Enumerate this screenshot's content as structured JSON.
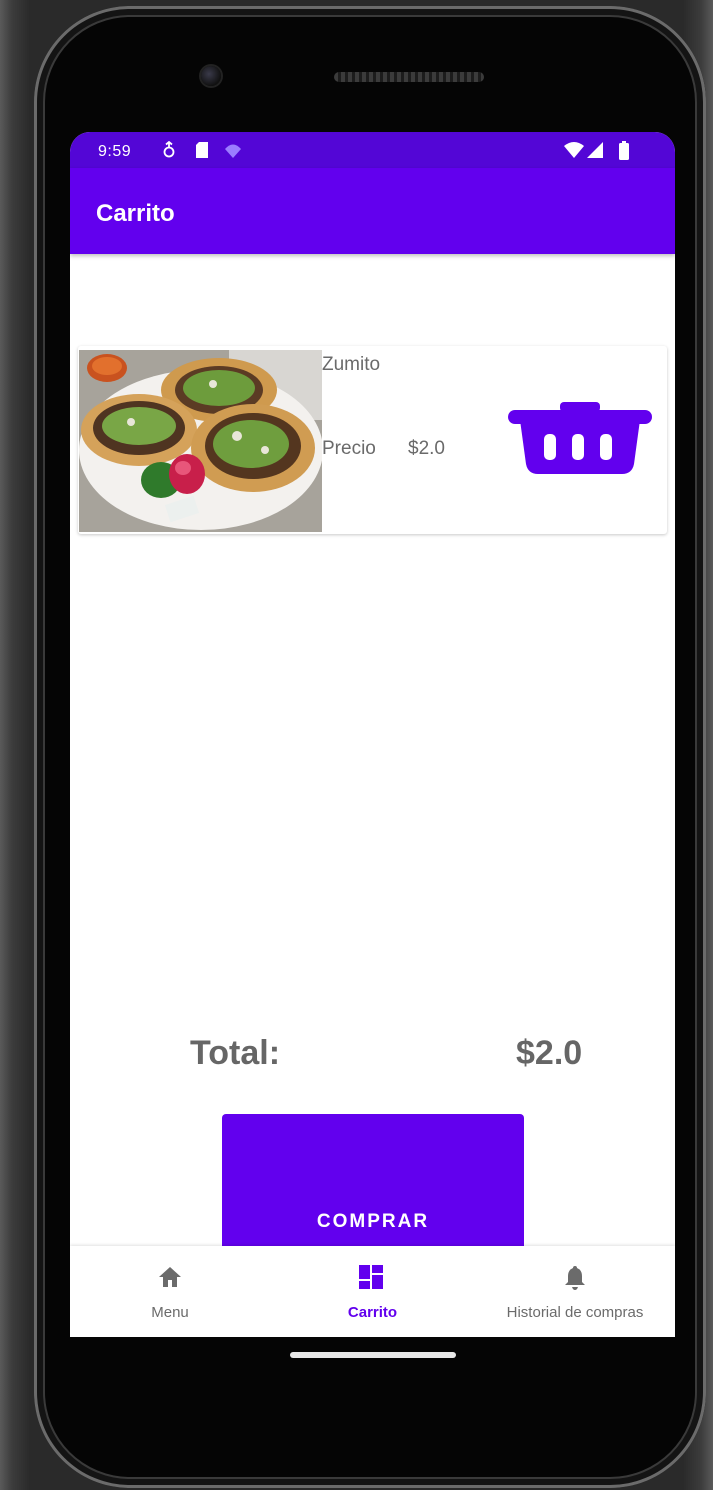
{
  "status_bar": {
    "time": "9:59",
    "icons": [
      "location-icon",
      "sd-card-icon",
      "vpn-key-icon",
      "wifi-icon",
      "signal-icon",
      "battery-icon"
    ]
  },
  "app_bar": {
    "title": "Carrito"
  },
  "cart": {
    "items": [
      {
        "name": "Zumito",
        "price_label": "Precio",
        "price": "$2.0",
        "image": "tacos-photo",
        "action_icon": "delete-basket-icon"
      }
    ]
  },
  "summary": {
    "total_label": "Total:",
    "total_value": "$2.0"
  },
  "buy_button": {
    "label": "COMPRAR"
  },
  "bottom_nav": {
    "items": [
      {
        "label": "Menu",
        "icon": "home-icon",
        "active": false
      },
      {
        "label": "Carrito",
        "icon": "dashboard-icon",
        "active": true
      },
      {
        "label": "Historial de compras",
        "icon": "bell-icon",
        "active": false
      }
    ]
  },
  "colors": {
    "primary": "#6200ee",
    "primary_dark": "#5306d6",
    "text_secondary": "#6b6b6b"
  }
}
